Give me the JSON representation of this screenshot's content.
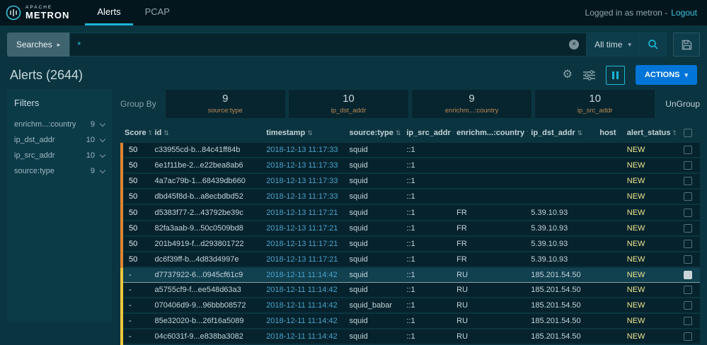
{
  "colors": {
    "accent_cyan": "#1bb6d6",
    "actions_blue": "#0275d8",
    "score_orange": "#df8434",
    "score_yellow": "#edc73a",
    "status_new": "#efe48e",
    "timestamp_blue": "#4ba3cc"
  },
  "icons": {
    "sort": "⇅",
    "caret_down": "▾",
    "caret_right": "▸",
    "gear": "⚙",
    "clear": "×"
  },
  "navbar": {
    "brand_top": "APACHE",
    "brand_bottom": "METRON",
    "tabs": [
      {
        "label": "Alerts"
      },
      {
        "label": "PCAP"
      }
    ],
    "logged_in_text": "Logged in as metron -",
    "logout_label": "Logout"
  },
  "search": {
    "searches_label": "Searches",
    "query": "*",
    "time_range": "All time"
  },
  "alerts_header": {
    "title": "Alerts (2644)",
    "actions_label": "ACTIONS"
  },
  "filters": {
    "title": "Filters",
    "items": [
      {
        "label": "enrichm...:country",
        "count": "9"
      },
      {
        "label": "ip_dst_addr",
        "count": "10"
      },
      {
        "label": "ip_src_addr",
        "count": "10"
      },
      {
        "label": "source:type",
        "count": "9"
      }
    ]
  },
  "group_by": {
    "label": "Group By",
    "ungroup_label": "UnGroup",
    "groups": [
      {
        "count": "9",
        "field": "source:type"
      },
      {
        "count": "10",
        "field": "ip_dst_addr"
      },
      {
        "count": "9",
        "field": "enrichm...:country"
      },
      {
        "count": "10",
        "field": "ip_src_addr"
      }
    ]
  },
  "table": {
    "columns": [
      "Score",
      "id",
      "timestamp",
      "source:type",
      "ip_src_addr",
      "enrichm...:country",
      "ip_dst_addr",
      "host",
      "alert_status"
    ],
    "rows": [
      {
        "score": "50",
        "severity": "orange",
        "id": "c33955cd-b...84c41ff84b",
        "timestamp": "2018-12-13 11:17:33",
        "source_type": "squid",
        "ip_src_addr": "::1",
        "country": "",
        "ip_dst_addr": "",
        "host": "",
        "status": "NEW",
        "selected": false
      },
      {
        "score": "50",
        "severity": "orange",
        "id": "6e1f11be-2...e22bea8ab6",
        "timestamp": "2018-12-13 11:17:33",
        "source_type": "squid",
        "ip_src_addr": "::1",
        "country": "",
        "ip_dst_addr": "",
        "host": "",
        "status": "NEW",
        "selected": false
      },
      {
        "score": "50",
        "severity": "orange",
        "id": "4a7ac79b-1...68439db660",
        "timestamp": "2018-12-13 11:17:33",
        "source_type": "squid",
        "ip_src_addr": "::1",
        "country": "",
        "ip_dst_addr": "",
        "host": "",
        "status": "NEW",
        "selected": false
      },
      {
        "score": "50",
        "severity": "orange",
        "id": "dbd45f8d-b...a8ecbdbd52",
        "timestamp": "2018-12-13 11:17:33",
        "source_type": "squid",
        "ip_src_addr": "::1",
        "country": "",
        "ip_dst_addr": "",
        "host": "",
        "status": "NEW",
        "selected": false
      },
      {
        "score": "50",
        "severity": "orange",
        "id": "d5383f77-2...43792be39c",
        "timestamp": "2018-12-13 11:17:21",
        "source_type": "squid",
        "ip_src_addr": "::1",
        "country": "FR",
        "ip_dst_addr": "5.39.10.93",
        "host": "",
        "status": "NEW",
        "selected": false
      },
      {
        "score": "50",
        "severity": "orange",
        "id": "82fa3aab-9...50c0509bd8",
        "timestamp": "2018-12-13 11:17:21",
        "source_type": "squid",
        "ip_src_addr": "::1",
        "country": "FR",
        "ip_dst_addr": "5.39.10.93",
        "host": "",
        "status": "NEW",
        "selected": false
      },
      {
        "score": "50",
        "severity": "orange",
        "id": "201b4919-f...d293801722",
        "timestamp": "2018-12-13 11:17:21",
        "source_type": "squid",
        "ip_src_addr": "::1",
        "country": "FR",
        "ip_dst_addr": "5.39.10.93",
        "host": "",
        "status": "NEW",
        "selected": false
      },
      {
        "score": "50",
        "severity": "orange",
        "id": "dc6f39ff-b...4d83d4997e",
        "timestamp": "2018-12-13 11:17:21",
        "source_type": "squid",
        "ip_src_addr": "::1",
        "country": "FR",
        "ip_dst_addr": "5.39.10.93",
        "host": "",
        "status": "NEW",
        "selected": false
      },
      {
        "score": "-",
        "severity": "yellow",
        "id": "d7737922-6...0945cf61c9",
        "timestamp": "2018-12-11 11:14:42",
        "source_type": "squid",
        "ip_src_addr": "::1",
        "country": "RU",
        "ip_dst_addr": "185.201.54.50",
        "host": "",
        "status": "NEW",
        "selected": true
      },
      {
        "score": "-",
        "severity": "yellow",
        "id": "a5755cf9-f...ee548d63a3",
        "timestamp": "2018-12-11 11:14:42",
        "source_type": "squid",
        "ip_src_addr": "::1",
        "country": "RU",
        "ip_dst_addr": "185.201.54.50",
        "host": "",
        "status": "NEW",
        "selected": false
      },
      {
        "score": "-",
        "severity": "yellow",
        "id": "070406d9-9...96bbb08572",
        "timestamp": "2018-12-11 11:14:42",
        "source_type": "squid_babar",
        "ip_src_addr": "::1",
        "country": "RU",
        "ip_dst_addr": "185.201.54.50",
        "host": "",
        "status": "NEW",
        "selected": false
      },
      {
        "score": "-",
        "severity": "yellow",
        "id": "85e32020-b...26f16a5089",
        "timestamp": "2018-12-11 11:14:42",
        "source_type": "squid",
        "ip_src_addr": "::1",
        "country": "RU",
        "ip_dst_addr": "185.201.54.50",
        "host": "",
        "status": "NEW",
        "selected": false
      },
      {
        "score": "-",
        "severity": "yellow",
        "id": "04c6031f-9...e838ba3082",
        "timestamp": "2018-12-11 11:14:42",
        "source_type": "squid",
        "ip_src_addr": "::1",
        "country": "RU",
        "ip_dst_addr": "185.201.54.50",
        "host": "",
        "status": "NEW",
        "selected": false
      }
    ]
  }
}
